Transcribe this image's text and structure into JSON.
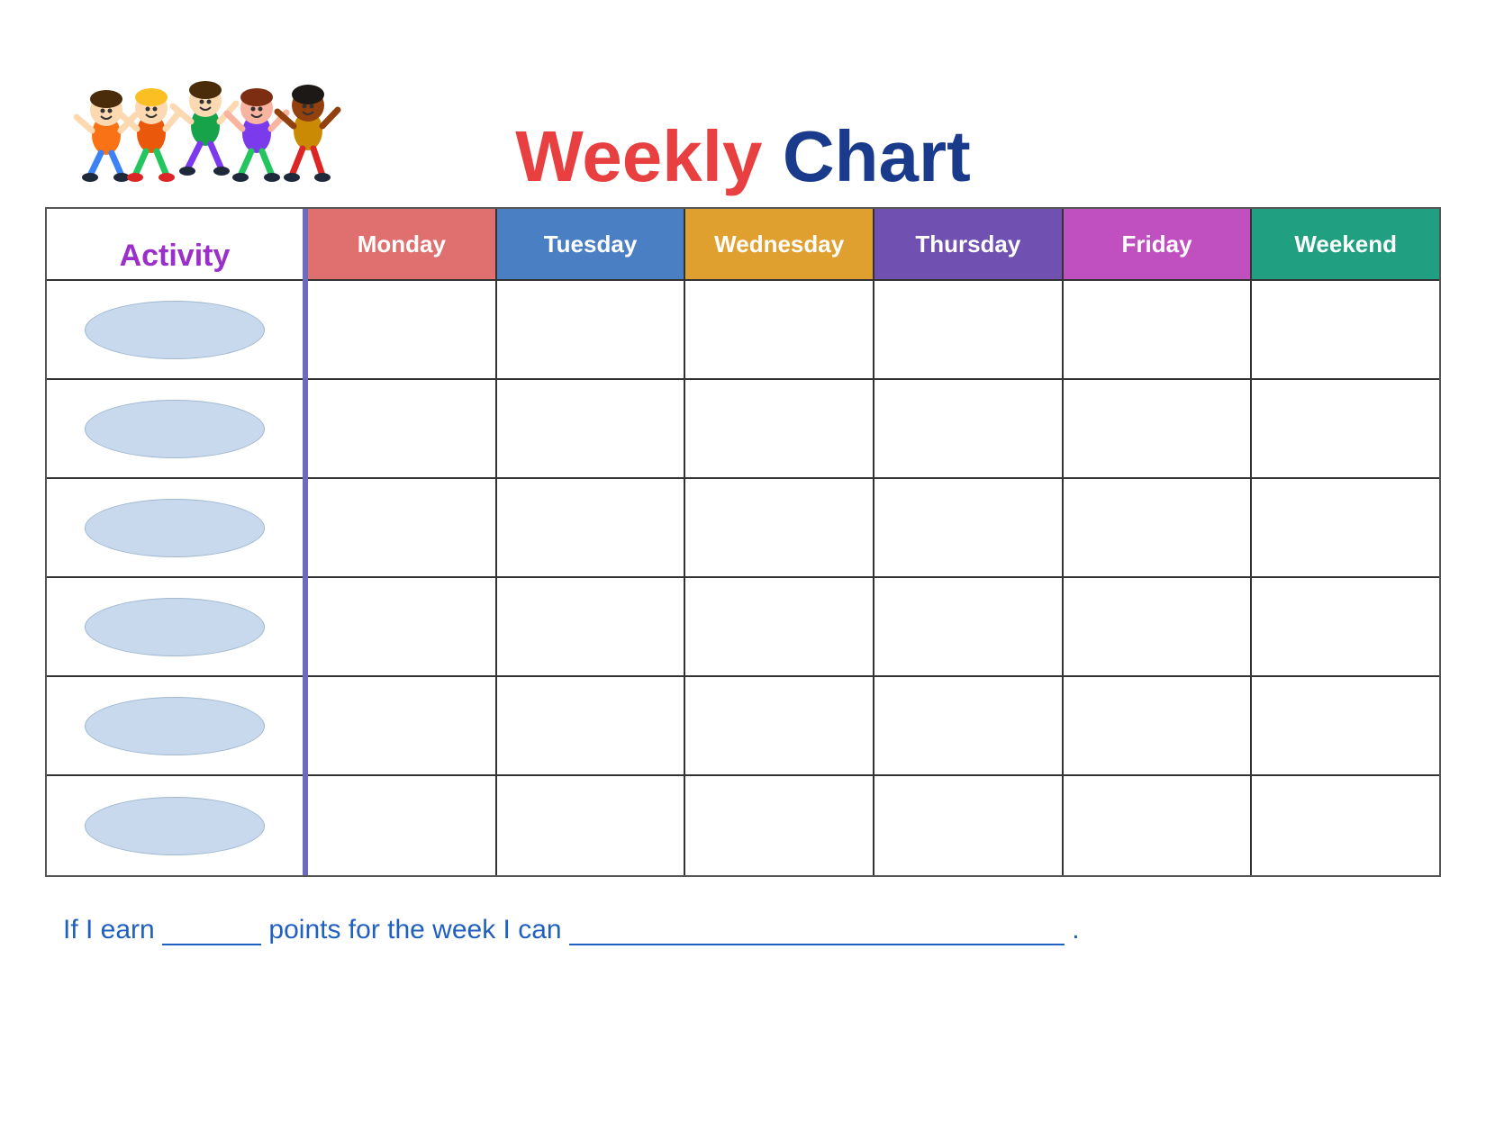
{
  "title": {
    "weekly": "Weekly",
    "chart": "Chart"
  },
  "header": {
    "activity_label": "Activity",
    "days": [
      {
        "id": "monday",
        "label": "Monday",
        "class": "day-monday"
      },
      {
        "id": "tuesday",
        "label": "Tuesday",
        "class": "day-tuesday"
      },
      {
        "id": "wednesday",
        "label": "Wednesday",
        "class": "day-wednesday"
      },
      {
        "id": "thursday",
        "label": "Thursday",
        "class": "day-thursday"
      },
      {
        "id": "friday",
        "label": "Friday",
        "class": "day-friday"
      },
      {
        "id": "weekend",
        "label": "Weekend",
        "class": "day-weekend"
      }
    ]
  },
  "rows": [
    {
      "id": 1
    },
    {
      "id": 2
    },
    {
      "id": 3
    },
    {
      "id": 4
    },
    {
      "id": 5
    },
    {
      "id": 6
    }
  ],
  "footer": {
    "text1": "If I earn",
    "text2": "points for the week I can",
    "text3": "."
  }
}
